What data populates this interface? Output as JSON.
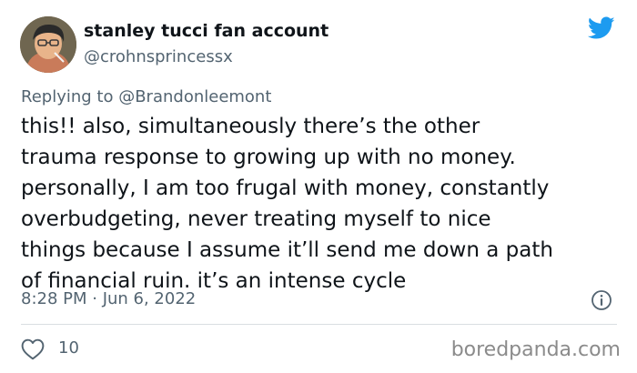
{
  "tweet": {
    "display_name": "stanley tucci fan account",
    "handle": "@crohnsprincessx",
    "replying_prefix": "Replying to ",
    "replying_to": "@Brandonleemont",
    "text": "this!! also, simultaneously there’s the other\ntrauma response to growing up with no money.\npersonally, I am too frugal with money, constantly\noverbudgeting, never treating myself to nice\nthings because I assume it’ll send me down a path\nof financial ruin. it’s an intense cycle",
    "timestamp": "8:28 PM · Jun 6, 2022",
    "likes": "10"
  },
  "watermark": "boredpanda.com",
  "icons": {
    "brand": "twitter-bird-icon",
    "info": "info-icon",
    "like": "heart-icon"
  },
  "colors": {
    "twitter_blue": "#1d9bf0",
    "text_primary": "#0f1419",
    "text_secondary": "#536471",
    "divider": "#d9dee2"
  }
}
